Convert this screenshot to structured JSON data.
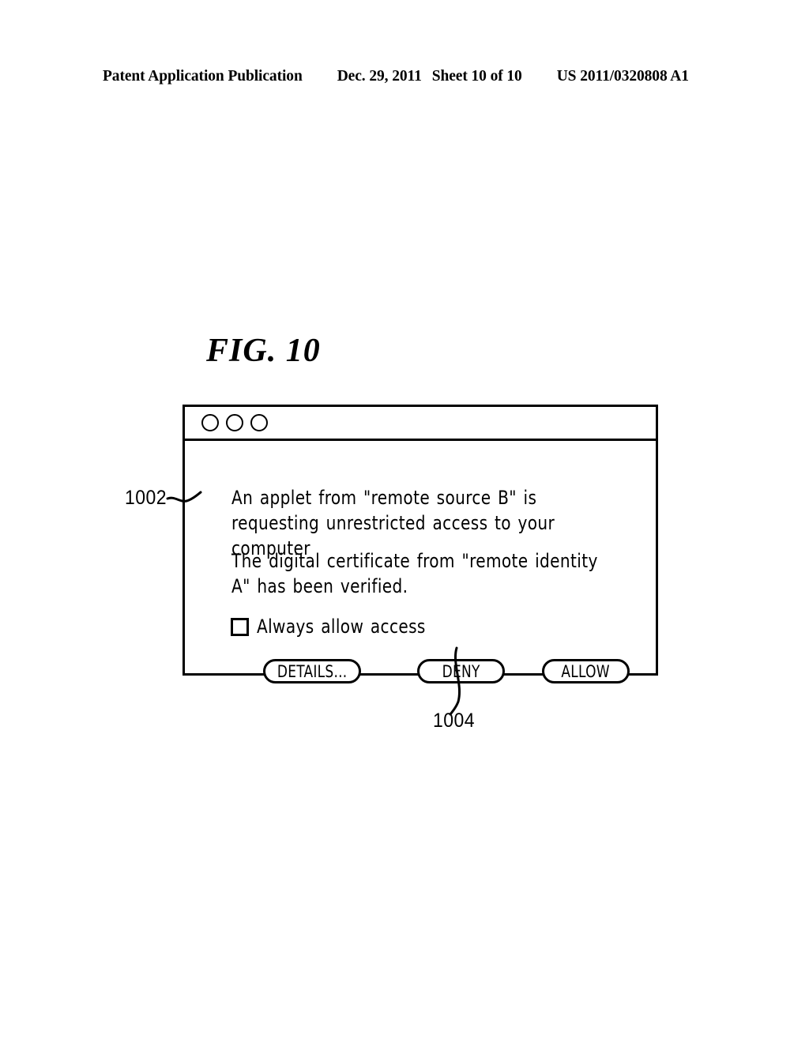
{
  "header": {
    "publication": "Patent Application Publication",
    "date": "Dec. 29, 2011",
    "sheet": "Sheet 10 of 10",
    "patent_number": "US 2011/0320808 A1"
  },
  "figure": {
    "label": "FIG. 10"
  },
  "dialog": {
    "window_controls": [
      {
        "name": "close-circle"
      },
      {
        "name": "minimize-circle"
      },
      {
        "name": "zoom-circle"
      }
    ],
    "messages": [
      "An applet from \"remote source B\" is requesting unrestricted access to your computer",
      "The digital certificate from \"remote identity A\" has been verified."
    ],
    "checkbox": {
      "label": "Always allow access",
      "checked": false
    },
    "buttons": [
      {
        "label": "DETAILS...",
        "name": "details-button"
      },
      {
        "label": "DENY",
        "name": "deny-button"
      },
      {
        "label": "ALLOW",
        "name": "allow-button"
      }
    ]
  },
  "reference_numerals": [
    {
      "id": "1002",
      "points_to": "dialog-window"
    },
    {
      "id": "1004",
      "points_to": "deny-button"
    }
  ],
  "colors": {
    "ink": "#000000",
    "page": "#ffffff"
  }
}
